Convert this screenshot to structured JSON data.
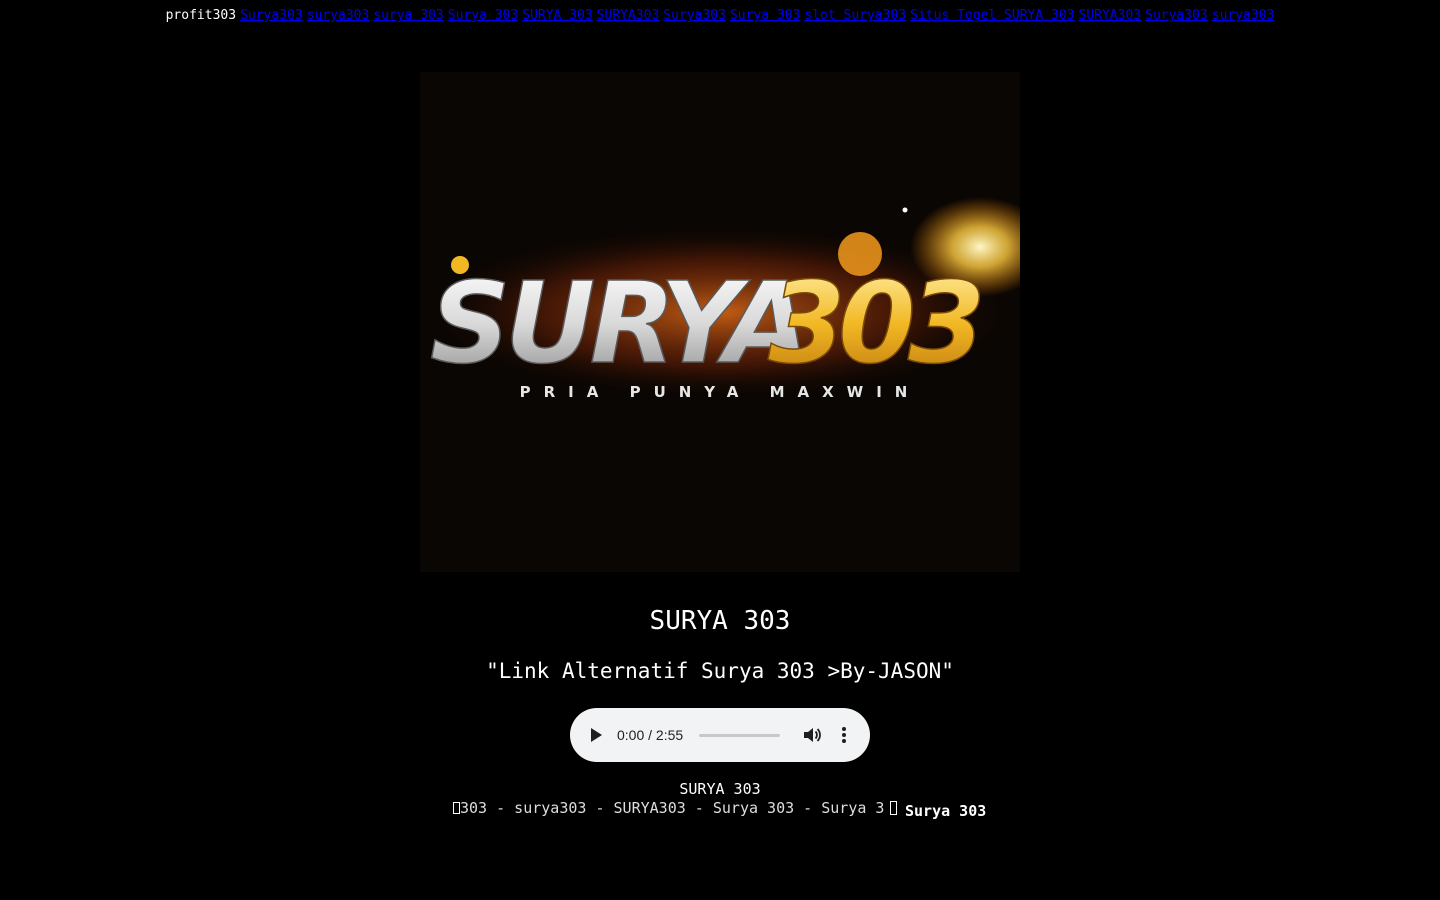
{
  "topbar": {
    "brand": "profit303",
    "links": [
      "Surya303",
      "surya303",
      "surya 303",
      "Surya 303",
      "SURYA 303",
      "SURYA303",
      "Surya303",
      "Surya 303",
      "slot Surya303",
      "Situs Togel SURYA 303",
      "SURYA303",
      "Surya303",
      "surya303"
    ],
    "link_color": "#0000ee"
  },
  "logo": {
    "wordmark_left": "SURYA",
    "wordmark_right": "303",
    "tagline": "PRIA PUNYA MAXWIN"
  },
  "main": {
    "title": "SURYA 303",
    "subtitle": "\"Link Alternatif Surya 303 >By-JASON\""
  },
  "audio_player": {
    "time": "0:00 / 2:55",
    "progress": 0,
    "icons": [
      "play-icon",
      "volume-icon",
      "more-options-icon"
    ]
  },
  "footer": {
    "title": "SURYA 303",
    "marquee": "303 - surya303 - SURYA303 - Surya 303 - Surya 3",
    "bold_label": "Surya 303"
  },
  "colors": {
    "background": "#000000",
    "text": "#ffffff",
    "gold": "#f2b824",
    "silver": "#d9d9d9"
  }
}
